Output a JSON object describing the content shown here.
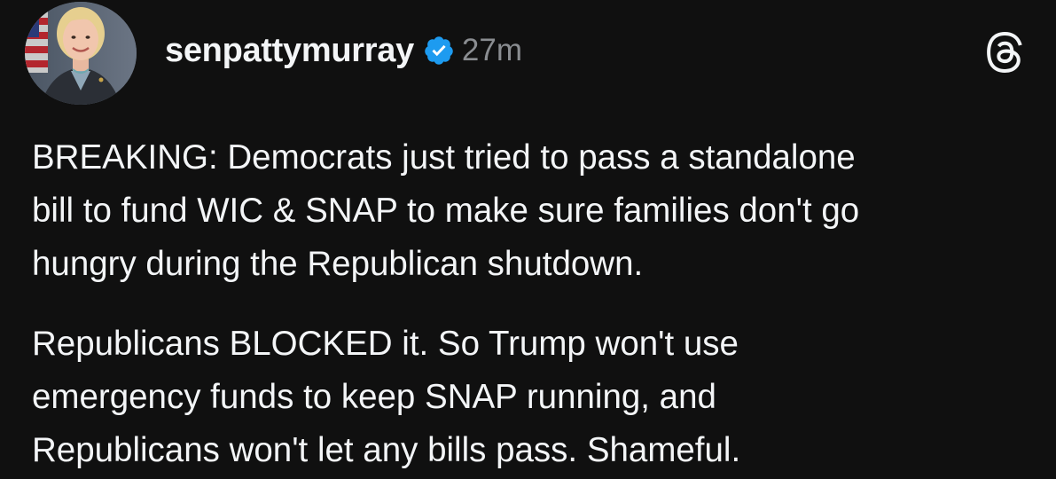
{
  "post": {
    "username": "senpattymurray",
    "timestamp": "27m",
    "verified": true,
    "avatar_icon": "profile-photo",
    "app_icon": "threads-logo-icon",
    "accent_color": "#1d9bf0",
    "paragraphs": [
      {
        "lines": [
          "BREAKING: Democrats just tried to pass a standalone",
          "bill to fund WIC & SNAP to make sure families don't go",
          "hungry during the Republican shutdown."
        ]
      },
      {
        "lines": [
          "Republicans BLOCKED it. So Trump won't use",
          "emergency funds to keep SNAP running, and",
          "Republicans won't let any bills pass. Shameful."
        ]
      }
    ]
  }
}
